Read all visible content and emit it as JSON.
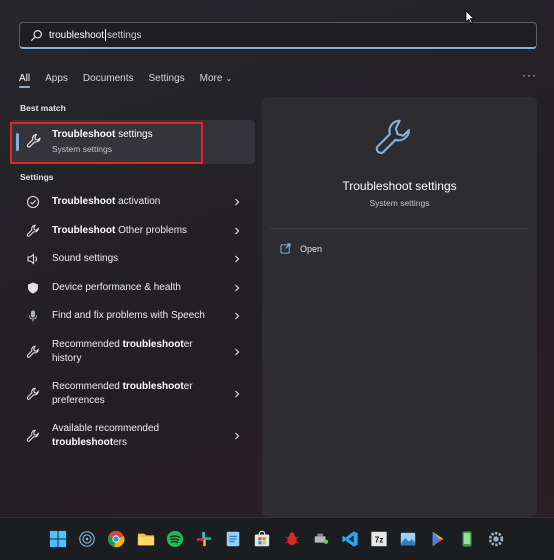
{
  "search": {
    "typed": "troubleshoot",
    "suggestion": " settings"
  },
  "filters": {
    "items": [
      {
        "label": "All"
      },
      {
        "label": "Apps"
      },
      {
        "label": "Documents"
      },
      {
        "label": "Settings"
      },
      {
        "label": "More"
      }
    ],
    "more_label": "···"
  },
  "sections": {
    "best_match": "Best match",
    "settings": "Settings"
  },
  "best_match": {
    "title_bold": "Troubleshoot",
    "title_rest": " settings",
    "subtitle": "System settings"
  },
  "results": [
    {
      "icon": "check-circle-icon",
      "pre": "",
      "bold": "Troubleshoot",
      "post": " activation"
    },
    {
      "icon": "wrench-icon",
      "pre": "",
      "bold": "Troubleshoot",
      "post": " Other problems"
    },
    {
      "icon": "speaker-icon",
      "pre": "Sound settings",
      "bold": "",
      "post": ""
    },
    {
      "icon": "shield-icon",
      "pre": "Device performance & health",
      "bold": "",
      "post": ""
    },
    {
      "icon": "microphone-icon",
      "pre": "Find and fix problems with Speech",
      "bold": "",
      "post": ""
    },
    {
      "icon": "wrench-icon",
      "pre": "Recommended ",
      "bold": "troubleshoot",
      "post": "er history"
    },
    {
      "icon": "wrench-icon",
      "pre": "Recommended ",
      "bold": "troubleshoot",
      "post": "er preferences"
    },
    {
      "icon": "wrench-icon",
      "pre": "Available recommended ",
      "bold": "troubleshoot",
      "post": "ers"
    }
  ],
  "preview": {
    "title": "Troubleshoot settings",
    "subtitle": "System settings",
    "open_label": "Open"
  },
  "colors": {
    "accent": "#7fb0e0",
    "highlight": "#e4262c"
  },
  "taskbar": {
    "icons": [
      "windows-start-icon",
      "wifi-icon",
      "chrome-icon",
      "file-explorer-icon",
      "spotify-icon",
      "slack-icon",
      "notepad-icon",
      "store-icon",
      "bug-icon",
      "devices-icon",
      "vscode-icon",
      "7zip-icon",
      "photos-icon",
      "play-store-icon",
      "phone-icon",
      "settings-gear-icon"
    ],
    "labels": {
      "sevenzip": "7z"
    }
  }
}
